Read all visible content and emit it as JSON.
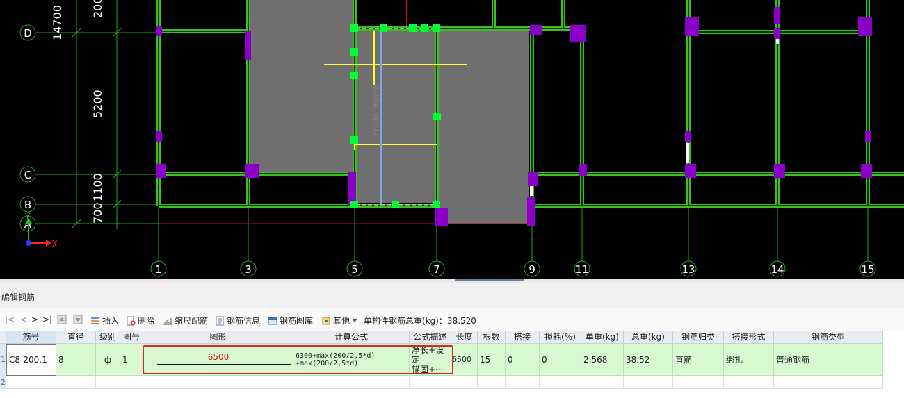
{
  "canvas": {
    "dimensions": [
      "14700",
      "200",
      "5200",
      "1100",
      "700"
    ],
    "axis_labels_row": [
      "D",
      "C",
      "B",
      "A"
    ],
    "axis_labels_col": [
      "1",
      "3",
      "5",
      "7",
      "9",
      "11",
      "13",
      "14",
      "15"
    ],
    "beam_label": "C8-200 L8@200",
    "ucs_x": "X",
    "ucs_y": "Y",
    "colors": {
      "wall": "#3fbf1f",
      "column": "#8b00c9",
      "slab": "#6f6f6f",
      "grip": "#00ff33",
      "rebar": "#ffff33"
    }
  },
  "panel": {
    "title": "编辑钢筋"
  },
  "toolbar": {
    "nav_first": "|<",
    "nav_prev": "<",
    "nav_next": ">",
    "nav_last": ">|",
    "insert": "插入",
    "delete": "删除",
    "scale_rebar": "缩尺配筋",
    "rebar_info": "钢筋信息",
    "rebar_library": "钢筋图库",
    "other": "其他",
    "total_weight": "单构件钢筋总重(kg)：38.520"
  },
  "table": {
    "headers": [
      "筋号",
      "直径(mm)",
      "级别",
      "图号",
      "图形",
      "计算公式",
      "公式描述",
      "长度",
      "根数",
      "搭接",
      "损耗(%)",
      "单重(kg)",
      "总重(kg)",
      "钢筋归类",
      "搭接形式",
      "钢筋类型"
    ],
    "rows": [
      {
        "num": "1",
        "bar_no": "C8-200.1",
        "diameter": "8",
        "grade": "ф",
        "shape_no": "1",
        "shape_value": "6500",
        "formula_line1": "6300+max(200/2,5*d)",
        "formula_line2": "+max(200/2,5*d)",
        "desc_line1": "净长+设定",
        "desc_line2": "锚固+···",
        "length": "6500",
        "count": "15",
        "lap": "0",
        "loss": "0",
        "unit_weight": "2.568",
        "total_weight": "38.52",
        "category": "直筋",
        "lap_type": "绑扎",
        "rebar_type": "普通钢筋"
      },
      {
        "num": "2"
      }
    ]
  }
}
